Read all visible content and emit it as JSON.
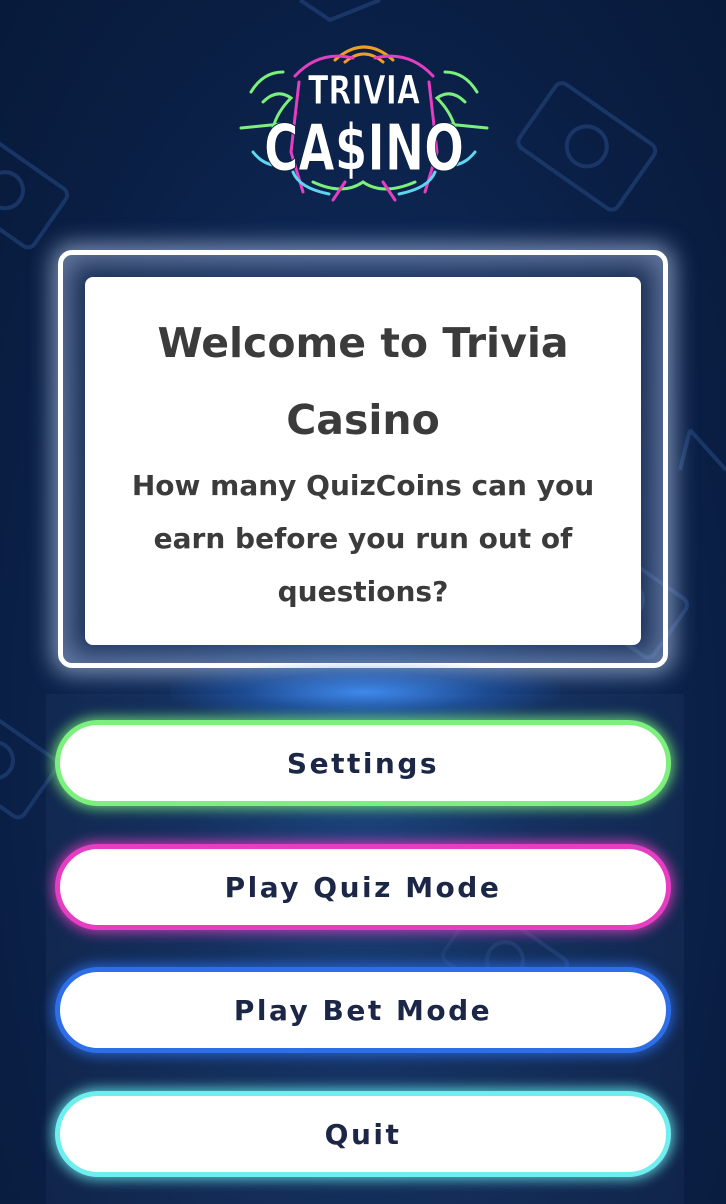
{
  "logo": {
    "line1": "TRIVIA",
    "line2": "CA$INO"
  },
  "welcome": {
    "title": "Welcome to Trivia Casino",
    "subtitle": "How many QuizCoins can you earn before you run out of questions?"
  },
  "menu": {
    "settings_label": "Settings",
    "quiz_label": "Play Quiz Mode",
    "bet_label": "Play Bet Mode",
    "quit_label": "Quit"
  },
  "colors": {
    "settings_border": "#7cf07c",
    "quiz_border": "#e63ec2",
    "bet_border": "#2e6fe8",
    "quit_border": "#6feef0",
    "background": "#0e2a58"
  },
  "icons": {
    "background_pattern": "money-bill-icon"
  }
}
